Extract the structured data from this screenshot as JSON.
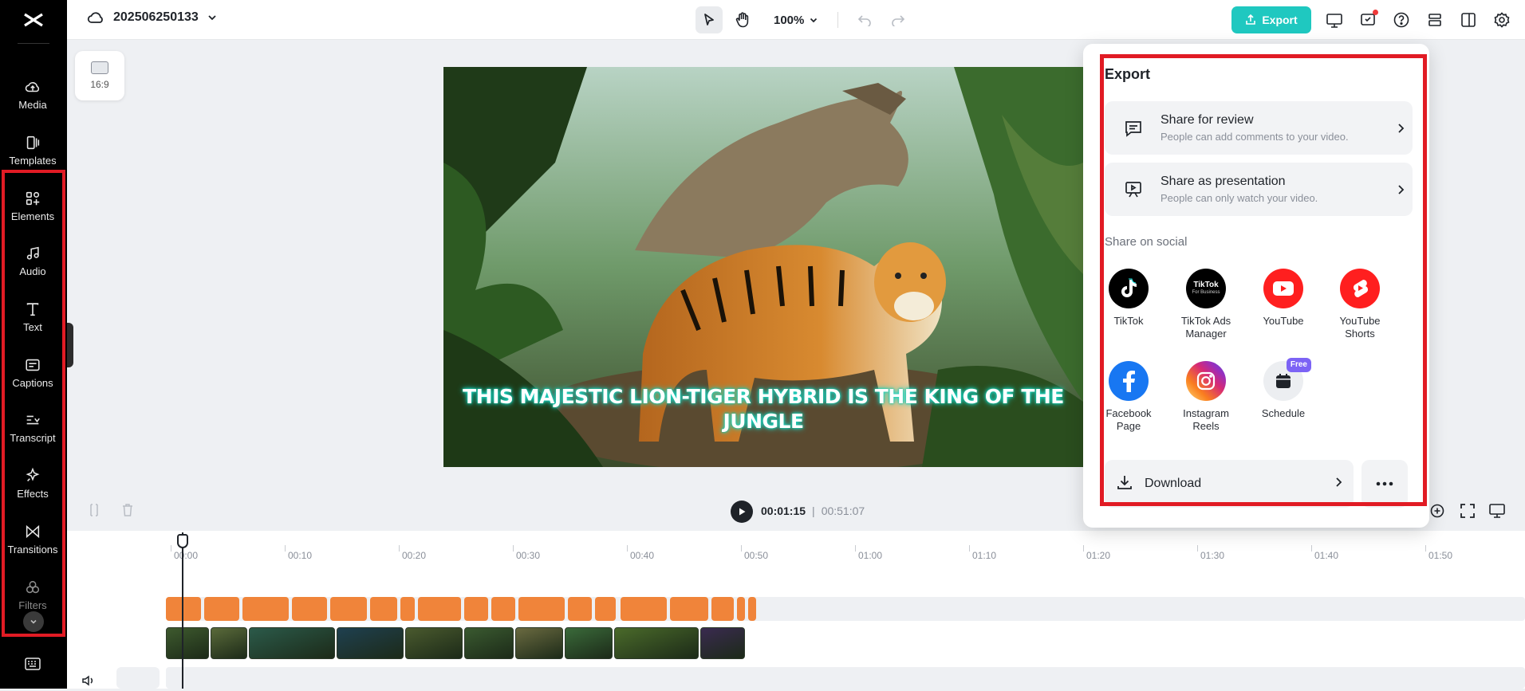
{
  "project": {
    "name": "202506250133"
  },
  "toolbar": {
    "zoom": "100%",
    "export_label": "Export"
  },
  "sidebar": {
    "items": [
      {
        "label": "Media",
        "icon": "cloud-upload-icon"
      },
      {
        "label": "Templates",
        "icon": "templates-icon"
      },
      {
        "label": "Elements",
        "icon": "elements-icon"
      },
      {
        "label": "Audio",
        "icon": "music-note-icon"
      },
      {
        "label": "Text",
        "icon": "text-t-icon"
      },
      {
        "label": "Captions",
        "icon": "captions-icon"
      },
      {
        "label": "Transcript",
        "icon": "transcript-icon"
      },
      {
        "label": "Effects",
        "icon": "effects-sparkle-icon"
      },
      {
        "label": "Transitions",
        "icon": "transitions-icon"
      },
      {
        "label": "Filters",
        "icon": "filters-icon"
      }
    ]
  },
  "canvas": {
    "ratio_label": "16:9"
  },
  "preview": {
    "caption_line1": "THIS MAJESTIC LION-TIGER HYBRID IS THE KING OF THE",
    "caption_line2": "JUNGLE"
  },
  "export_panel": {
    "title": "Export",
    "share_review": {
      "title": "Share for review",
      "subtitle": "People can add comments to your video."
    },
    "share_presentation": {
      "title": "Share as presentation",
      "subtitle": "People can only watch your video."
    },
    "social_title": "Share on social",
    "social": [
      {
        "label": "TikTok",
        "color": "#000000"
      },
      {
        "label": "TikTok Ads Manager",
        "color": "#000000",
        "logo_text": "TikTok",
        "logo_sub": "For Business"
      },
      {
        "label": "YouTube",
        "color": "#ff1f1f"
      },
      {
        "label": "YouTube Shorts",
        "color": "#ff1f1f"
      },
      {
        "label": "Facebook Page",
        "color": "#1877f2"
      },
      {
        "label": "Instagram Reels",
        "color": "#d62976"
      },
      {
        "label": "Schedule",
        "color": "#eceef1",
        "badge": "Free"
      }
    ],
    "download_label": "Download"
  },
  "player": {
    "current_time": "00:01:15",
    "total_time": "00:51:07"
  },
  "timeline": {
    "ruler": [
      "00:00",
      "00:10",
      "00:20",
      "00:30",
      "00:40",
      "00:50",
      "01:00",
      "01:10",
      "01:20",
      "01:30",
      "01:40",
      "01:50"
    ]
  },
  "colors": {
    "accent": "#1fc8c0",
    "highlight": "#e11b24",
    "caption_clip": "#f0843a"
  }
}
